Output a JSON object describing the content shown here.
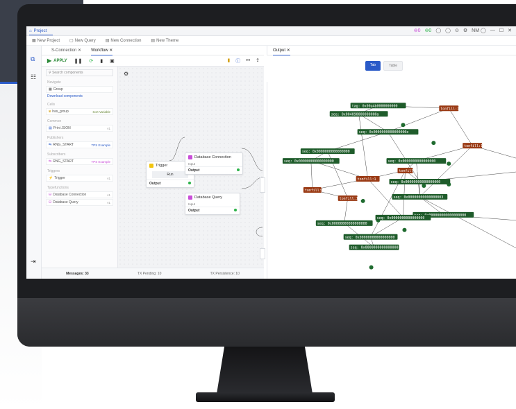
{
  "app": {
    "title": "Project"
  },
  "title_controls": [
    "⊚0",
    "⊚0",
    "◯",
    "◯",
    "⊙",
    "⚙",
    "NM ◯",
    "—",
    "☐",
    "✕"
  ],
  "menubar": [
    {
      "icon": "grid-icon",
      "label": "New Project"
    },
    {
      "icon": "query-icon",
      "label": "New Query"
    },
    {
      "icon": "connection-icon",
      "label": "New Connection"
    },
    {
      "icon": "theme-icon",
      "label": "New Theme"
    }
  ],
  "left_tabs": [
    {
      "label": "S-Connection",
      "active": false
    },
    {
      "label": "Workflow",
      "active": true
    }
  ],
  "toolbar": {
    "apply_label": "APPLY"
  },
  "panel": {
    "search_placeholder": "Search components",
    "groups": [
      {
        "title": "Navigate",
        "items": [
          {
            "label": "Group",
            "badge": ""
          }
        ]
      },
      {
        "title": "",
        "link": "Download components",
        "items": []
      },
      {
        "title": "Cells",
        "items": [
          {
            "label": "has_group",
            "badge": "Sort Variable"
          }
        ]
      },
      {
        "title": "Common",
        "items": [
          {
            "label": "Print JSON",
            "badge": "v1"
          }
        ]
      },
      {
        "title": "Publishers",
        "items": [
          {
            "label": "RNG_START",
            "badge": "TPS Example"
          }
        ]
      },
      {
        "title": "Subscribers",
        "items": [
          {
            "label": "RNG_START",
            "badge": "TPS Example"
          }
        ]
      },
      {
        "title": "Triggers",
        "items": [
          {
            "label": "Trigger",
            "badge": "v1"
          }
        ]
      },
      {
        "title": "Typefunctions",
        "items": [
          {
            "label": "Database Connection",
            "badge": "v1"
          },
          {
            "label": "Database Query",
            "badge": "v1"
          }
        ]
      }
    ]
  },
  "nodes": {
    "trigger": {
      "title": "Trigger",
      "run": "Run",
      "output": "Output"
    },
    "db_conn": {
      "title": "Database Connection",
      "input": "Input",
      "output": "Output"
    },
    "db_query": {
      "title": "Database Query",
      "input": "Input",
      "output": "Output"
    }
  },
  "statusbar": [
    "Messages: 33",
    "TX Pending: 10",
    "TX Persistence: 10"
  ],
  "output": {
    "tab_label": "Output",
    "toggle": [
      "Tab",
      "Table"
    ],
    "graph_nodes": [
      {
        "t": "tag: 0x00a4b0000000000",
        "c": "g"
      },
      {
        "t": "seq: 0x004090000000000a",
        "c": "g"
      },
      {
        "t": "seq: 0x0000000000000000e",
        "c": "g"
      },
      {
        "t": "seq: 0x0000000000000000",
        "c": "g"
      },
      {
        "t": "seq: 0x00000000000000000",
        "c": "g"
      },
      {
        "t": "seq: 0x0000000000000000",
        "c": "g"
      },
      {
        "t": "seq: 0x00000000000000003",
        "c": "g"
      },
      {
        "t": "tag: 0x000000000000000000",
        "c": "g"
      },
      {
        "t": "seq: 0x00000000000000000",
        "c": "g"
      },
      {
        "t": "seq: 0x00000000000000000",
        "c": "g"
      },
      {
        "t": "seq: 0x0000000000000000",
        "c": "g"
      },
      {
        "t": "seq: 0x00000000000000000",
        "c": "g"
      },
      {
        "t": "seq: 0x0000000000000000",
        "c": "g"
      },
      {
        "t": "tonfill:1.12",
        "c": "r"
      },
      {
        "t": "tonfill:1.8",
        "c": "r"
      },
      {
        "t": "tonfill:1",
        "c": "r"
      },
      {
        "t": "tonfill:1",
        "c": "r"
      },
      {
        "t": "tonfill:1.0",
        "c": "r"
      },
      {
        "t": "tonfill:1.1",
        "c": "r"
      },
      {
        "t": "tonfill:1.1",
        "c": "r"
      }
    ]
  }
}
